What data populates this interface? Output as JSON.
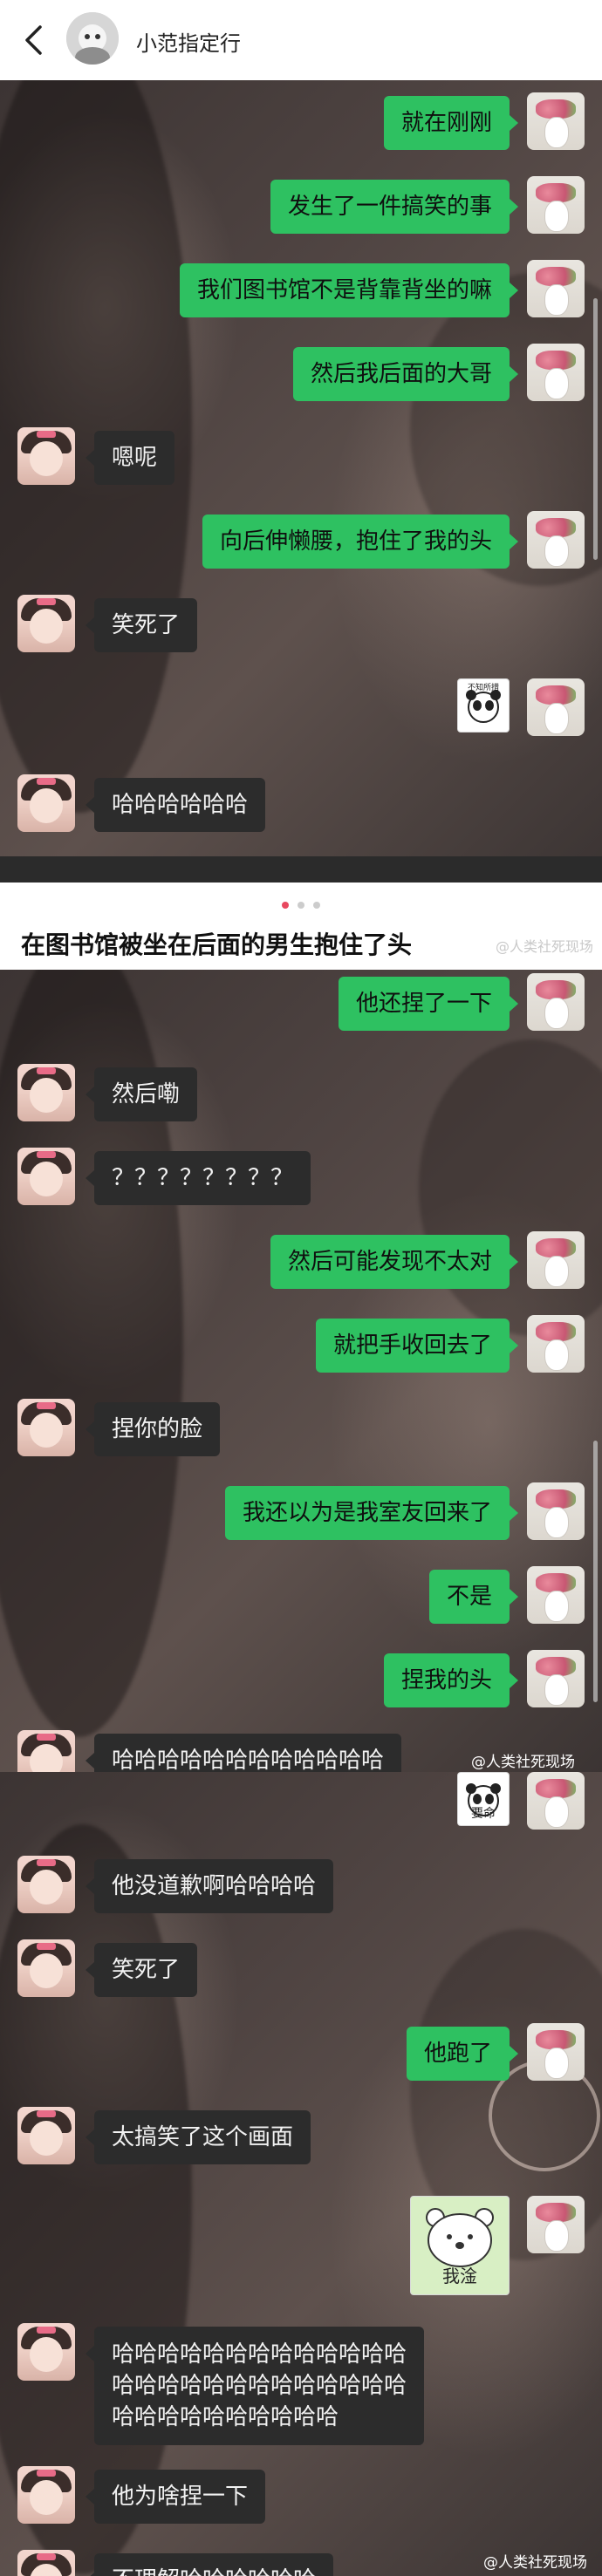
{
  "header": {
    "back_icon": "chevron-left-icon",
    "contact_name": "小范指定行"
  },
  "section1": {
    "messages": [
      {
        "side": "right",
        "text": "就在刚刚"
      },
      {
        "side": "right",
        "text": "发生了一件搞笑的事"
      },
      {
        "side": "right",
        "text": "我们图书馆不是背靠背坐的嘛"
      },
      {
        "side": "right",
        "text": "然后我后面的大哥"
      },
      {
        "side": "left",
        "text": "嗯呢"
      },
      {
        "side": "right",
        "text": "向后伸懒腰，抱住了我的头"
      },
      {
        "side": "left",
        "text": "笑死了"
      },
      {
        "side": "right",
        "sticker_caption": "不知所措"
      },
      {
        "side": "left",
        "text": "哈哈哈哈哈哈"
      }
    ]
  },
  "post": {
    "title": "在图书馆被坐在后面的男生抱住了头",
    "watermark": "@人类社死现场",
    "page_dots": 3
  },
  "section2": {
    "messages": [
      {
        "side": "right",
        "text": "他还捏了一下"
      },
      {
        "side": "left",
        "text": "然后嘞"
      },
      {
        "side": "left",
        "text": "？？？？？？？？"
      },
      {
        "side": "right",
        "text": "然后可能发现不太对"
      },
      {
        "side": "right",
        "text": "就把手收回去了"
      },
      {
        "side": "left",
        "text": "捏你的脸"
      },
      {
        "side": "right",
        "text": "我还以为是我室友回来了"
      },
      {
        "side": "right",
        "text": "不是"
      },
      {
        "side": "right",
        "text": "捏我的头"
      },
      {
        "side": "left",
        "text": "哈哈哈哈哈哈哈哈哈哈哈哈"
      }
    ],
    "watermark": "@人类社死现场"
  },
  "section3": {
    "messages": [
      {
        "side": "right",
        "sticker_caption": "要命"
      },
      {
        "side": "left",
        "text": "他没道歉啊哈哈哈哈"
      },
      {
        "side": "left",
        "text": "笑死了"
      },
      {
        "side": "right",
        "text": "他跑了"
      },
      {
        "side": "left",
        "text": "太搞笑了这个画面"
      },
      {
        "side": "right",
        "sticker_caption": "我淦"
      },
      {
        "side": "left",
        "lines": [
          "哈哈哈哈哈哈哈哈哈哈哈哈哈",
          "哈哈哈哈哈哈哈哈哈哈哈哈哈",
          "哈哈哈哈哈哈哈哈哈哈"
        ]
      },
      {
        "side": "left",
        "text": "他为啥捏一下"
      },
      {
        "side": "left",
        "text": "不理解哈哈哈哈哈哈"
      }
    ],
    "watermark": "@人类社死现场"
  },
  "colors": {
    "sent_bubble": "#2ec161",
    "received_bubble": "#2c2c2c",
    "active_dot": "#e8485f",
    "inactive_dot": "#cccccc"
  }
}
